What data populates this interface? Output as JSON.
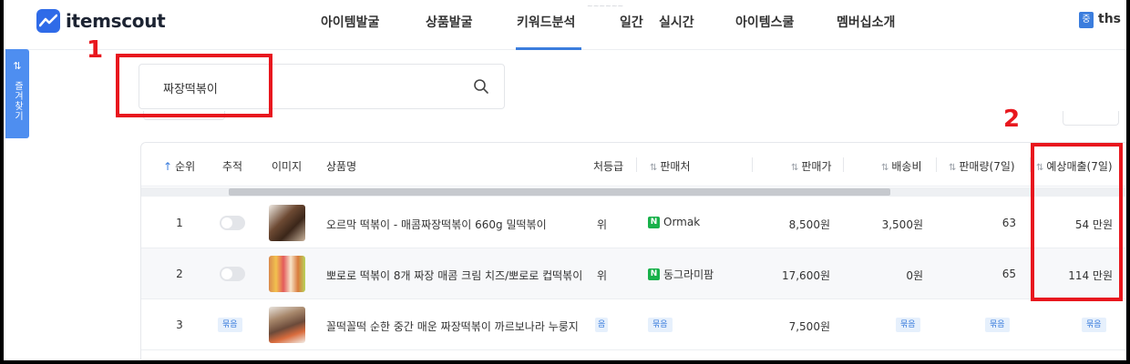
{
  "header": {
    "logo_text": "itemscout",
    "nav": [
      "아이템발굴",
      "상품발굴",
      "키워드분석",
      "일간",
      "실시간",
      "아이템스쿨",
      "멤버십소개"
    ],
    "nav_sub": "~~~~~~",
    "user_badge": "중",
    "user_name": "ths"
  },
  "sidebar": {
    "favorites_label": "즐겨찾기",
    "favorites_icon": "⇅"
  },
  "search": {
    "value": "짜장떡볶이"
  },
  "annotations": {
    "label_1": "1",
    "label_2": "2",
    "color": "#e8171e"
  },
  "table": {
    "columns": {
      "rank": "순위",
      "track": "추적",
      "image": "이미지",
      "name": "상품명",
      "grade": "처등급",
      "seller": "판매처",
      "price": "판매가",
      "shipping": "배송비",
      "qty": "판매량(7일)",
      "sales": "예상매출(7일)"
    },
    "rows": [
      {
        "rank": "1",
        "name": "오르막 떡볶이 - 매콤짜장떡볶이 660g 밀떡볶이",
        "grade": "위",
        "seller": "Ormak",
        "seller_icon": "N",
        "price": "8,500원",
        "shipping": "3,500원",
        "qty": "63",
        "sales": "54 만원"
      },
      {
        "rank": "2",
        "name": "뽀로로 떡볶이 8개 짜장 매콤 크림 치즈/뽀로로 컵떡볶이",
        "grade": "위",
        "seller": "동그라미팜",
        "seller_icon": "N",
        "price": "17,600원",
        "shipping": "0원",
        "qty": "65",
        "sales": "114 만원"
      },
      {
        "rank": "3",
        "name": "꼴떡꼴떡 순한 중간 매운 짜장떡볶이 까르보나라 누룽지",
        "track_tag": "묶음",
        "grade_tag": "음",
        "seller_tag": "묶음",
        "price": "7,500원",
        "shipping_tag": "묶음",
        "qty_tag": "묶음",
        "sales_tag": "묶음"
      }
    ]
  }
}
